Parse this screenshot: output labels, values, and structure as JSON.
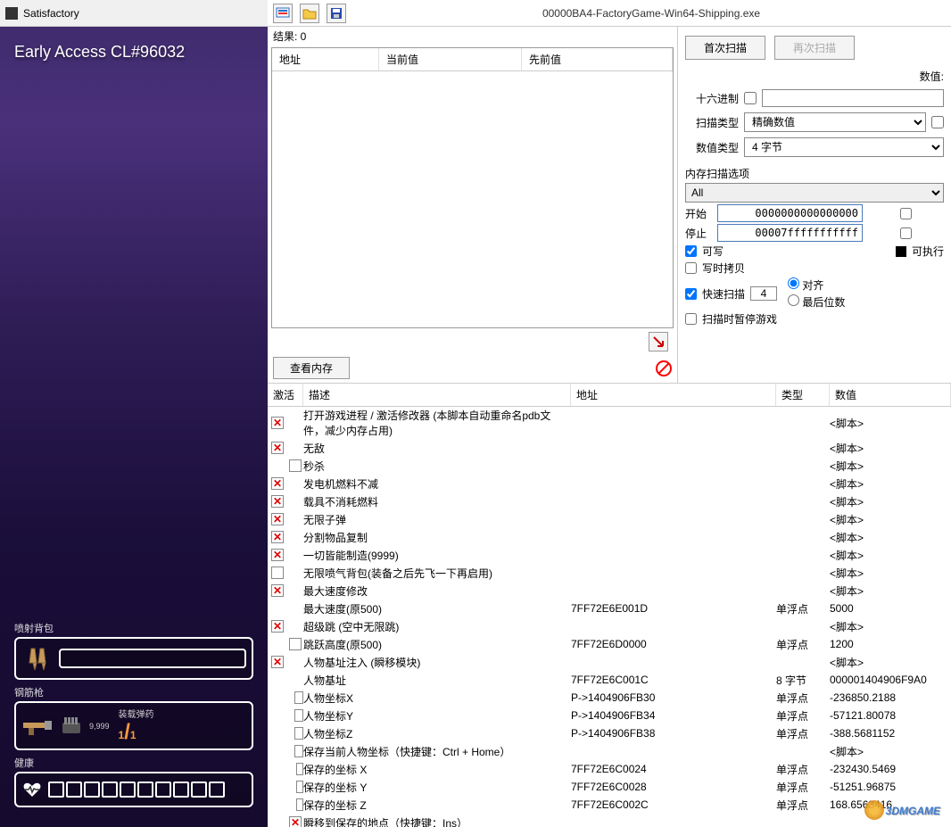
{
  "game": {
    "window_title": "Satisfactory",
    "early_access": "Early Access CL#96032",
    "hud": {
      "jetpack_label": "喷射背包",
      "weapon_label": "钢筋枪",
      "ammo_label": "装载弹药",
      "ammo_current": "1",
      "ammo_max": "1",
      "ammo_reserve": "9,999",
      "health_label": "健康"
    }
  },
  "ce": {
    "process_title": "00000BA4-FactoryGame-Win64-Shipping.exe",
    "results_label": "结果: 0",
    "result_cols": {
      "addr": "地址",
      "curr": "当前值",
      "prev": "先前值"
    },
    "view_memory": "查看内存",
    "scan": {
      "first_scan": "首次扫描",
      "next_scan": "再次扫描",
      "value_label": "数值:",
      "hex_label": "十六进制",
      "scan_type_label": "扫描类型",
      "scan_type_value": "精确数值",
      "value_type_label": "数值类型",
      "value_type_value": "4 字节",
      "mem_options_label": "内存扫描选项",
      "mem_options_value": "All",
      "start_label": "开始",
      "start_value": "0000000000000000",
      "stop_label": "停止",
      "stop_value": "00007fffffffffff",
      "writable": "可写",
      "executable": "可执行",
      "copy_on_write": "写时拷贝",
      "fast_scan": "快速扫描",
      "fast_scan_value": "4",
      "alignment": "对齐",
      "last_digits": "最后位数",
      "pause_game": "扫描时暂停游戏"
    },
    "table_cols": {
      "active": "激活",
      "desc": "描述",
      "addr": "地址",
      "type": "类型",
      "value": "数值"
    },
    "rows": [
      {
        "indent": 0,
        "checked": true,
        "desc": "打开游戏进程 / 激活修改器 (本脚本自动重命名pdb文件，减少内存占用)",
        "addr": "",
        "type": "",
        "value": "<脚本>"
      },
      {
        "indent": 0,
        "checked": true,
        "desc": "无敌",
        "addr": "",
        "type": "",
        "value": "<脚本>"
      },
      {
        "indent": 1,
        "checked": false,
        "desc": "秒杀",
        "addr": "",
        "type": "",
        "value": "<脚本>"
      },
      {
        "indent": 0,
        "checked": true,
        "desc": "发电机燃料不减",
        "addr": "",
        "type": "",
        "value": "<脚本>"
      },
      {
        "indent": 0,
        "checked": true,
        "desc": "载具不消耗燃料",
        "addr": "",
        "type": "",
        "value": "<脚本>"
      },
      {
        "indent": 0,
        "checked": true,
        "desc": "无限子弹",
        "addr": "",
        "type": "",
        "value": "<脚本>"
      },
      {
        "indent": 0,
        "checked": true,
        "desc": "分割物品复制",
        "addr": "",
        "type": "",
        "value": "<脚本>"
      },
      {
        "indent": 0,
        "checked": true,
        "desc": "一切皆能制造(9999)",
        "addr": "",
        "type": "",
        "value": "<脚本>"
      },
      {
        "indent": 0,
        "checked": false,
        "desc": "无限喷气背包(装备之后先飞一下再启用)",
        "addr": "",
        "type": "",
        "value": "<脚本>"
      },
      {
        "indent": 0,
        "checked": true,
        "desc": "最大速度修改",
        "addr": "",
        "type": "",
        "value": "<脚本>"
      },
      {
        "indent": 1,
        "checked": null,
        "desc": "最大速度(原500)",
        "addr": "7FF72E6E001D",
        "type": "单浮点",
        "value": "5000"
      },
      {
        "indent": 0,
        "checked": true,
        "desc": "超级跳 (空中无限跳)",
        "addr": "",
        "type": "",
        "value": "<脚本>"
      },
      {
        "indent": 1,
        "checked": false,
        "desc": "跳跃高度(原500)",
        "addr": "7FF72E6D0000",
        "type": "单浮点",
        "value": "1200"
      },
      {
        "indent": 0,
        "checked": true,
        "desc": "人物基址注入 (瞬移模块)",
        "addr": "",
        "type": "",
        "value": "<脚本>"
      },
      {
        "indent": 1,
        "checked": null,
        "desc": "人物基址",
        "addr": "7FF72E6C001C",
        "type": "8 字节",
        "value": "000001404906F9A0"
      },
      {
        "indent": 2,
        "checked": false,
        "desc": "人物坐标X",
        "addr": "P->1404906FB30",
        "type": "单浮点",
        "value": "-236850.2188"
      },
      {
        "indent": 2,
        "checked": false,
        "desc": "人物坐标Y",
        "addr": "P->1404906FB34",
        "type": "单浮点",
        "value": "-57121.80078"
      },
      {
        "indent": 2,
        "checked": false,
        "desc": "人物坐标Z",
        "addr": "P->1404906FB38",
        "type": "单浮点",
        "value": "-388.5681152"
      },
      {
        "indent": 2,
        "checked": false,
        "desc": "保存当前人物坐标（快捷键：Ctrl + Home）",
        "addr": "",
        "type": "",
        "value": "<脚本>"
      },
      {
        "indent": 3,
        "checked": false,
        "desc": "保存的坐标 X",
        "addr": "7FF72E6C0024",
        "type": "单浮点",
        "value": "-232430.5469"
      },
      {
        "indent": 3,
        "checked": false,
        "desc": "保存的坐标 Y",
        "addr": "7FF72E6C0028",
        "type": "单浮点",
        "value": "-51251.96875"
      },
      {
        "indent": 3,
        "checked": false,
        "desc": "保存的坐标 Z",
        "addr": "7FF72E6C002C",
        "type": "单浮点",
        "value": "168.6563416"
      },
      {
        "indent": 1,
        "checked": true,
        "desc": "瞬移到保存的地点（快捷键：Ins）",
        "addr": "",
        "type": "",
        "value": ""
      }
    ],
    "watermark": "3DMGAME"
  }
}
